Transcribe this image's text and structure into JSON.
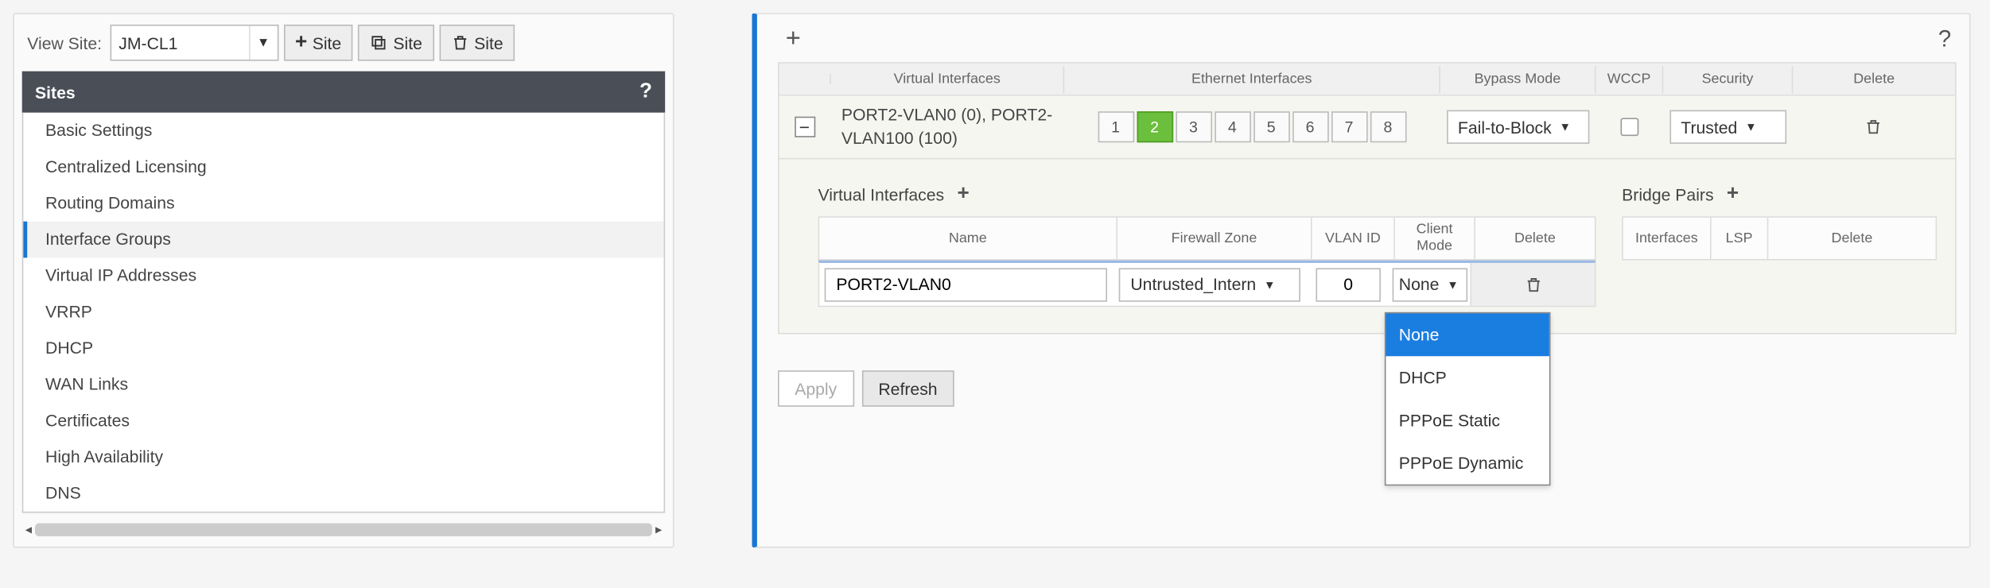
{
  "left": {
    "view_site_label": "View Site:",
    "selected_site": "JM-CL1",
    "toolbar": {
      "add": "Site",
      "clone": "Site",
      "delete": "Site"
    },
    "nav_header": "Sites",
    "nav_help": "?",
    "nav_items": [
      "Basic Settings",
      "Centralized Licensing",
      "Routing Domains",
      "Interface Groups",
      "Virtual IP Addresses",
      "VRRP",
      "DHCP",
      "WAN Links",
      "Certificates",
      "High Availability",
      "DNS"
    ],
    "selected_index": 3
  },
  "right": {
    "help": "?",
    "headers": {
      "vi": "Virtual Interfaces",
      "eth": "Ethernet Interfaces",
      "bypass": "Bypass Mode",
      "wccp": "WCCP",
      "security": "Security",
      "delete": "Delete"
    },
    "row": {
      "vi_text": "PORT2-VLAN0 (0), PORT2-VLAN100 (100)",
      "ports": [
        "1",
        "2",
        "3",
        "4",
        "5",
        "6",
        "7",
        "8"
      ],
      "active_port_index": 1,
      "bypass": "Fail-to-Block",
      "security": "Trusted"
    },
    "expanded": {
      "vi_title": "Virtual Interfaces",
      "bp_title": "Bridge Pairs",
      "vi_headers": {
        "name": "Name",
        "zone": "Firewall Zone",
        "vlan": "VLAN ID",
        "client": "Client Mode",
        "del": "Delete"
      },
      "bp_headers": {
        "if": "Interfaces",
        "lsp": "LSP",
        "del": "Delete"
      },
      "vi_row": {
        "name": "PORT2-VLAN0",
        "zone": "Untrusted_Intern",
        "vlan": "0",
        "client": "None"
      },
      "client_options": [
        "None",
        "DHCP",
        "PPPoE Static",
        "PPPoE Dynamic"
      ],
      "client_selected_index": 0
    },
    "actions": {
      "apply": "Apply",
      "refresh": "Refresh"
    }
  }
}
